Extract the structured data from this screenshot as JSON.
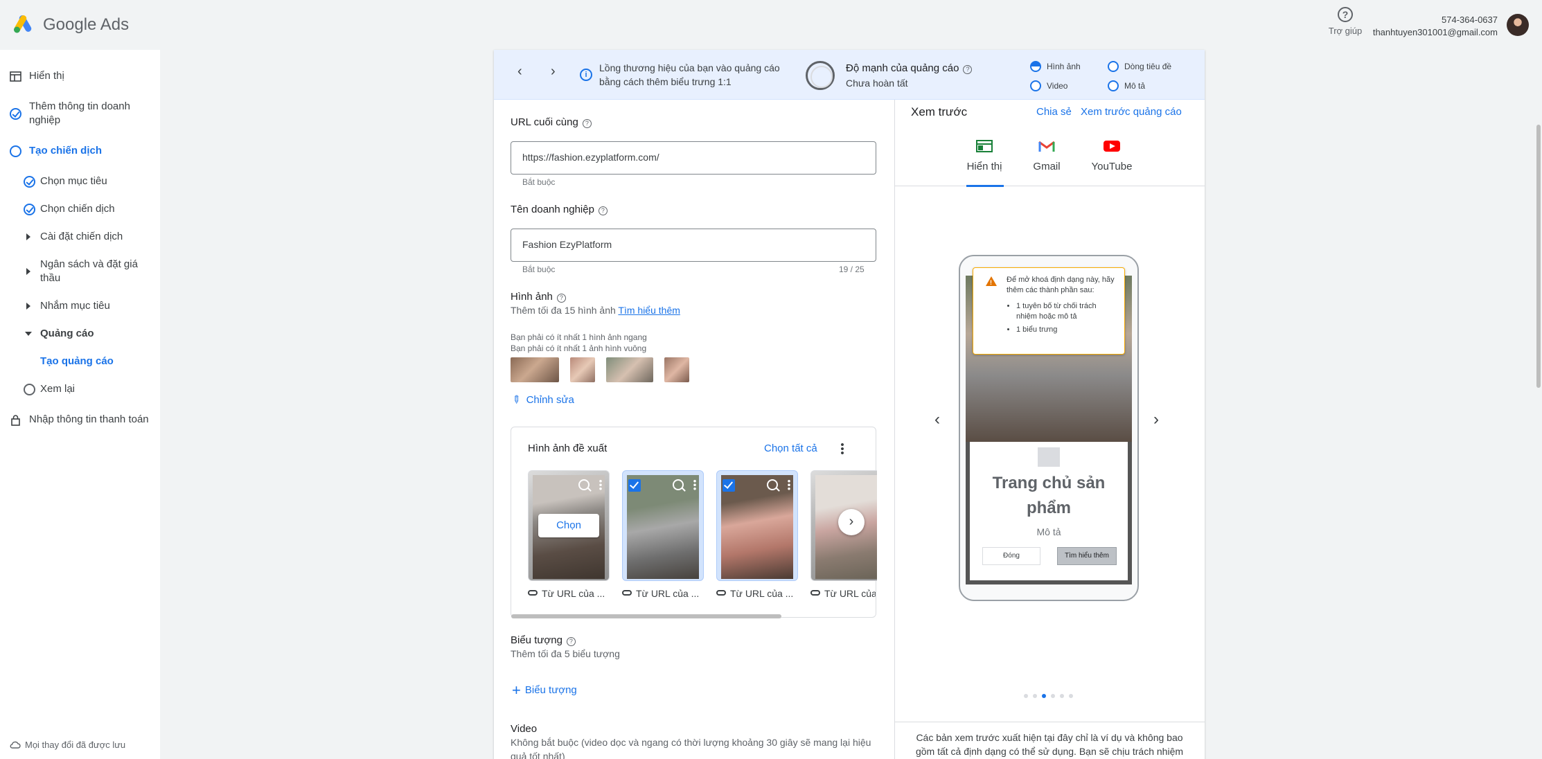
{
  "header": {
    "brand": "Google Ads",
    "help_label": "Trợ giúp",
    "phone": "574-364-0637",
    "email": "thanhtuyen301001@gmail.com"
  },
  "sidebar": {
    "items": [
      {
        "label": "Hiển thị",
        "state": "done-icon"
      },
      {
        "label": "Thêm thông tin doanh nghiệp",
        "state": "check-icon"
      },
      {
        "label": "Tạo chiến dịch",
        "state": "active"
      },
      {
        "label": "Chọn mục tiêu",
        "state": "check-icon"
      },
      {
        "label": "Chọn chiến dịch",
        "state": "check-icon"
      },
      {
        "label": "Cài đặt chiến dịch",
        "state": "collapsed"
      },
      {
        "label": "Ngân sách và đặt giá thầu",
        "state": "collapsed"
      },
      {
        "label": "Nhắm mục tiêu",
        "state": "collapsed"
      },
      {
        "label": "Quảng cáo",
        "state": "expanded"
      },
      {
        "label": "Tạo quảng cáo",
        "state": "active"
      },
      {
        "label": "Xem lại",
        "state": "empty"
      },
      {
        "label": "Nhập thông tin thanh toán",
        "state": "lock-icon"
      }
    ],
    "saved_status": "Mọi thay đổi đã được lưu"
  },
  "banner": {
    "message": "Lồng thương hiệu của bạn vào quảng cáo bằng cách thêm biểu trưng 1:1",
    "strength_title": "Độ mạnh của quảng cáo",
    "strength_status": "Chưa hoàn tất",
    "requirements": [
      "Hình ảnh",
      "Dòng tiêu đề",
      "Video",
      "Mô tả"
    ]
  },
  "form": {
    "final_url": {
      "label": "URL cuối cùng",
      "value": "https://fashion.ezyplatform.com/",
      "hint": "Bắt buộc"
    },
    "business_name": {
      "label": "Tên doanh nghiệp",
      "value": "Fashion EzyPlatform",
      "hint": "Bắt buộc",
      "counter": "19 / 25"
    },
    "images": {
      "label": "Hình ảnh",
      "subtitle": "Thêm tối đa 15 hình ảnh",
      "learn_more": "Tìm hiểu thêm",
      "req1": "Bạn phải có ít nhất 1 hình ảnh ngang",
      "req2": "Bạn phải có ít nhất 1 ảnh hình vuông",
      "edit": "Chỉnh sửa"
    },
    "suggested": {
      "title": "Hình ảnh đề xuất",
      "select_all": "Chọn tất cả",
      "choose": "Chọn",
      "items": [
        {
          "source": "Từ URL của ...",
          "selected": false
        },
        {
          "source": "Từ URL của ...",
          "selected": true
        },
        {
          "source": "Từ URL của ...",
          "selected": true
        },
        {
          "source": "Từ URL của",
          "selected": false
        }
      ]
    },
    "logos": {
      "label": "Biểu tượng",
      "subtitle": "Thêm tối đa 5 biểu tượng",
      "add": "Biểu tượng"
    },
    "video": {
      "label": "Video",
      "subtitle": "Không bắt buộc (video dọc và ngang có thời lượng khoảng 30 giây sẽ mang lại hiệu quả tốt nhất)"
    }
  },
  "preview": {
    "title": "Xem trước",
    "share": "Chia sẻ",
    "preview_ad": "Xem trước quảng cáo",
    "tabs": [
      "Hiển thị",
      "Gmail",
      "YouTube"
    ],
    "warning_text": "Để mở khoá định dạng này, hãy thêm các thành phần sau:",
    "warning_items": [
      "1 tuyên bố từ chối trách nhiệm hoặc mô tả",
      "1 biểu trưng"
    ],
    "ad_headline": "Trang chủ sản phẩm",
    "ad_description": "Mô tả",
    "close_btn": "Đóng",
    "learn_btn": "Tìm hiểu thêm",
    "carousel_page": 3,
    "carousel_total": 6,
    "disclaimer": "Các bản xem trước xuất hiện tại đây chỉ là ví dụ và không bao gồm tất cả định dạng có thể sử dụng. Bạn sẽ chịu trách nhiệm"
  }
}
